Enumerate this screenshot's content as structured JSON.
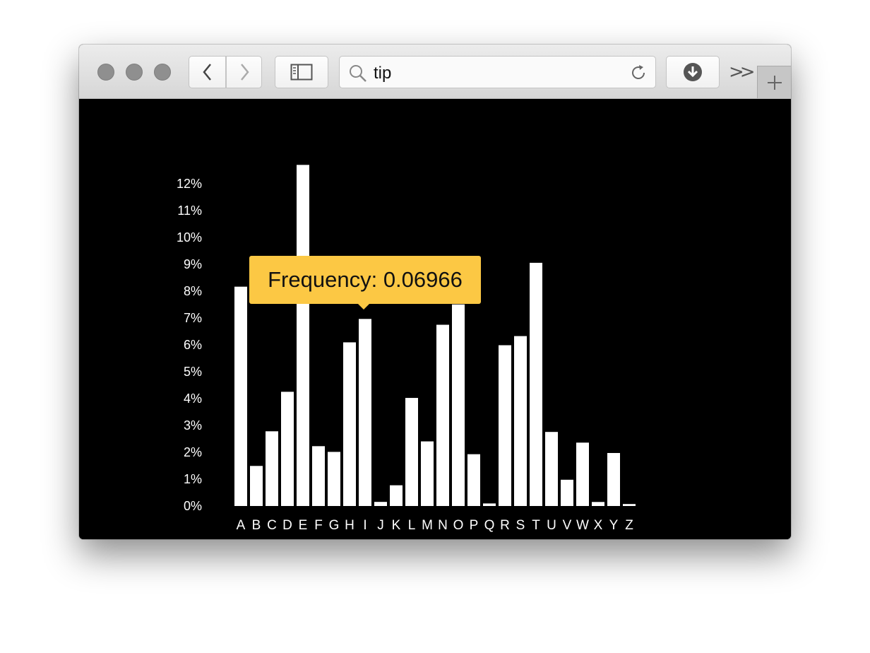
{
  "browser": {
    "url_text": "tip",
    "overflow_label": ">>",
    "colors": {
      "chrome": "#dcdcdc",
      "traffic_light": "#8f8f8f"
    }
  },
  "tooltip": {
    "label": "Frequency:",
    "value": "0.06966",
    "text": "Frequency: 0.06966",
    "color": "#fcc844"
  },
  "chart_data": {
    "type": "bar",
    "title": "",
    "xlabel": "",
    "ylabel": "",
    "categories": [
      "A",
      "B",
      "C",
      "D",
      "E",
      "F",
      "G",
      "H",
      "I",
      "J",
      "K",
      "L",
      "M",
      "N",
      "O",
      "P",
      "Q",
      "R",
      "S",
      "T",
      "U",
      "V",
      "W",
      "X",
      "Y",
      "Z"
    ],
    "values": [
      0.08167,
      0.01492,
      0.02782,
      0.04253,
      0.12702,
      0.02228,
      0.02015,
      0.06094,
      0.06966,
      0.00153,
      0.00772,
      0.04025,
      0.02406,
      0.06749,
      0.07507,
      0.01929,
      0.00095,
      0.05987,
      0.06327,
      0.09056,
      0.02758,
      0.00978,
      0.0236,
      0.0015,
      0.01974,
      0.00074
    ],
    "ylim": [
      0,
      0.12
    ],
    "yticks": [
      "0%",
      "1%",
      "2%",
      "3%",
      "4%",
      "5%",
      "6%",
      "7%",
      "8%",
      "9%",
      "10%",
      "11%",
      "12%"
    ],
    "grid": false,
    "bar_color": "#ffffff",
    "background": "#000000",
    "text_color": "#ffffff"
  }
}
